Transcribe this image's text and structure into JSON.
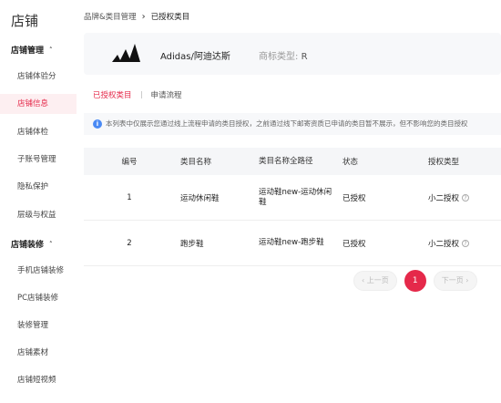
{
  "sidebar": {
    "title": "店铺",
    "groups": [
      {
        "label": "店铺管理",
        "items": [
          "店铺体验分",
          "店铺信息",
          "店铺体检",
          "子账号管理",
          "隐私保护",
          "层级与权益"
        ]
      },
      {
        "label": "店铺装修",
        "items": [
          "手机店铺装修",
          "PC店铺装修",
          "装修管理",
          "店铺素材",
          "店铺短视频"
        ]
      }
    ],
    "active_item": "店铺信息"
  },
  "breadcrumb": {
    "parent": "品牌&类目管理",
    "sep": "›",
    "current": "已授权类目"
  },
  "brand": {
    "name": "Adidas/阿迪达斯",
    "type_label": "商标类型:",
    "type_value": "R"
  },
  "tabs": [
    {
      "label": "已授权类目",
      "active": true
    },
    {
      "label": "申请流程",
      "active": false
    }
  ],
  "notice": {
    "text": "本列表中仅展示您通过线上流程申请的类目授权，之前通过线下邮寄资质已申请的类目暂不展示，但不影响您的类目授权"
  },
  "table": {
    "headers": [
      "编号",
      "类目名称",
      "类目名称全路径",
      "状态",
      "授权类型"
    ],
    "rows": [
      {
        "id": "1",
        "name": "运动休闲鞋",
        "path": "运动鞋new-运动休闲鞋",
        "status": "已授权",
        "auth": "小二授权"
      },
      {
        "id": "2",
        "name": "跑步鞋",
        "path": "运动鞋new-跑步鞋",
        "status": "已授权",
        "auth": "小二授权"
      }
    ]
  },
  "pager": {
    "prev": "‹ 上一页",
    "page": "1",
    "next": "下一页 ›"
  },
  "colors": {
    "accent": "#e5294a"
  }
}
